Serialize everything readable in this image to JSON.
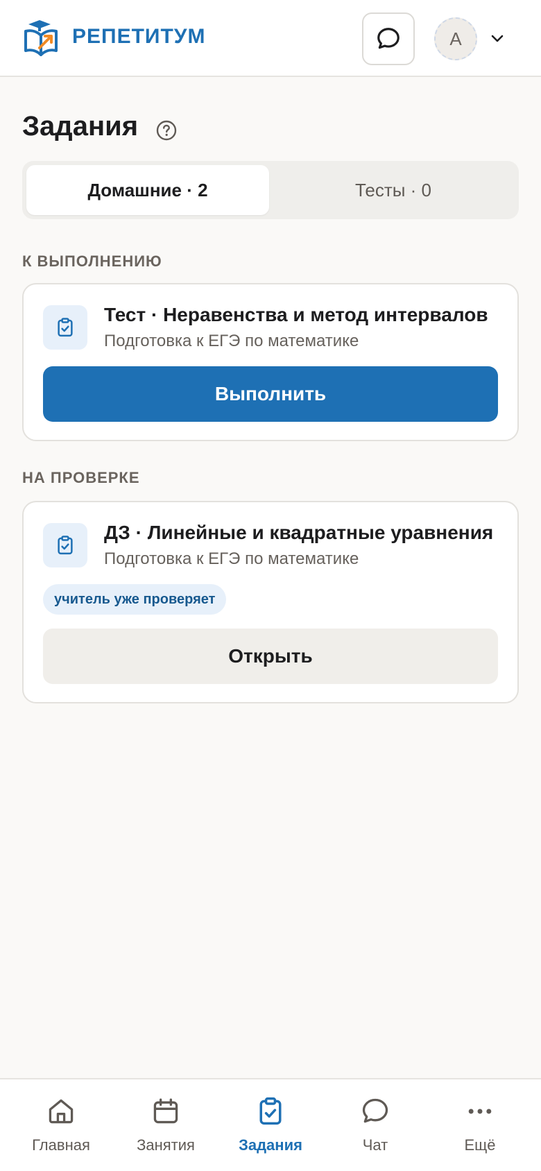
{
  "header": {
    "brand": "РЕПЕТИТУМ",
    "logo_icon": "graduation-book-logo",
    "chat_icon": "chat-bubble-icon",
    "avatar_letter": "A",
    "menu_icon": "chevron-down-icon"
  },
  "page": {
    "title": "Задания",
    "help_icon": "question-circle-icon"
  },
  "tabs": [
    {
      "label": "Домашние · 2",
      "active": true
    },
    {
      "label": "Тесты · 0",
      "active": false
    }
  ],
  "sections": [
    {
      "label": "К ВЫПОЛНЕНИЮ",
      "card": {
        "icon": "clipboard-check-icon",
        "title": "Тест · Неравенства и метод интервалов",
        "subtitle": "Подготовка к ЕГЭ по математике",
        "button": "Выполнить"
      }
    },
    {
      "label": "НА ПРОВЕРКЕ",
      "card": {
        "icon": "clipboard-check-icon",
        "title": "ДЗ · Линейные и квадратные уравнения",
        "subtitle": "Подготовка к ЕГЭ по математике",
        "badge": "учитель уже проверяет",
        "button": "Открыть"
      }
    }
  ],
  "bottom_nav": [
    {
      "label": "Главная",
      "icon": "home-icon",
      "active": false
    },
    {
      "label": "Занятия",
      "icon": "calendar-icon",
      "active": false
    },
    {
      "label": "Задания",
      "icon": "clipboard-check-icon",
      "active": true
    },
    {
      "label": "Чат",
      "icon": "chat-bubble-icon",
      "active": false
    },
    {
      "label": "Ещё",
      "icon": "more-dots-icon",
      "active": false
    }
  ],
  "colors": {
    "accent": "#1e70b4",
    "background": "#faf9f7",
    "orange": "#f08a24"
  }
}
